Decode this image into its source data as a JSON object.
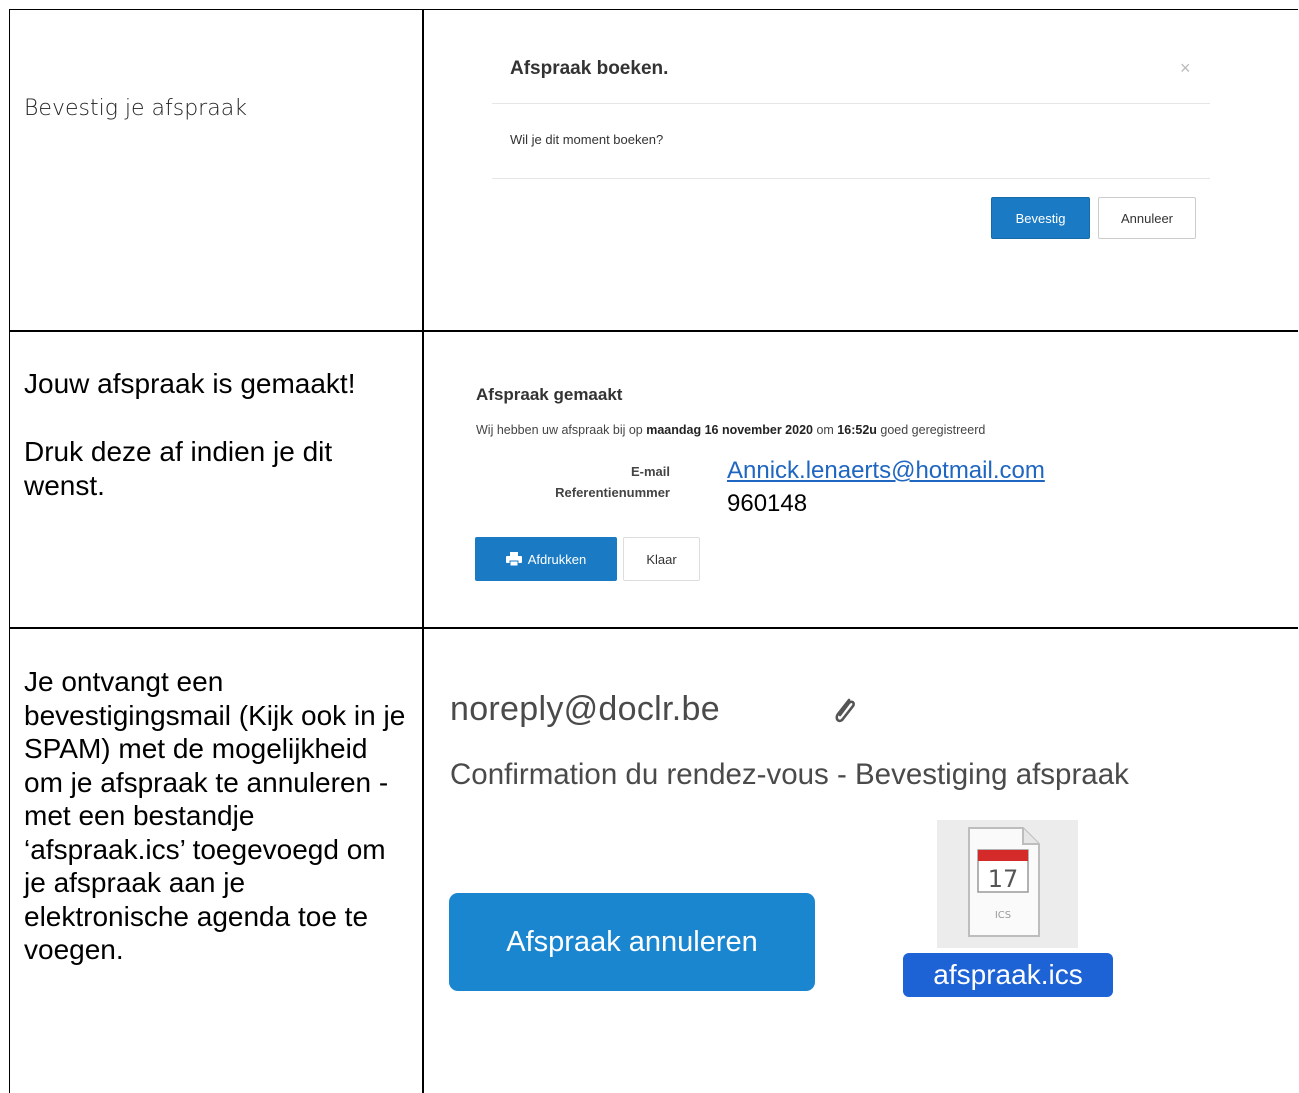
{
  "row1": {
    "instruction": "Bevestig je afspraak",
    "dialog": {
      "title": "Afspraak boeken.",
      "close": "×",
      "question": "Wil je dit moment boeken?",
      "confirm_label": "Bevestig",
      "cancel_label": "Annuleer"
    }
  },
  "row2": {
    "instruction_1": "Jouw afspraak is gemaakt!",
    "instruction_2": "Druk deze af indien je dit wenst.",
    "confirmation": {
      "title": "Afspraak gemaakt",
      "text_prefix": "Wij hebben uw afspraak bij op ",
      "date": "maandag 16 november 2020",
      "text_mid": " om ",
      "time": "16:52u",
      "text_suffix": " goed geregistreerd",
      "email_label": "E-mail",
      "reference_label": "Referentienummer",
      "email_value": "Annick.lenaerts@hotmail.com",
      "reference_value": "960148",
      "print_label": "Afdrukken",
      "done_label": "Klaar"
    }
  },
  "row3": {
    "instruction": "Je ontvangt een bevestigingsmail (Kijk ook in je SPAM) met de mogelijkheid om je afspraak te annuleren - met een bestandje ‘afspraak.ics’ toegevoegd om je afspraak aan je elektronische agenda toe te voegen.",
    "mail": {
      "from": "noreply@doclr.be",
      "subject": "Confirmation du rendez-vous - Bevestiging afspraak",
      "cancel_button_label": "Afspraak annuleren",
      "calendar_day": "17",
      "file_type": "ICS",
      "attachment_name": "afspraak.ics"
    }
  },
  "colors": {
    "button_blue": "#1a7bc4",
    "link_blue": "#1f66c1",
    "attachment_highlight": "#1d63d6",
    "calendar_red": "#d42a2a"
  }
}
